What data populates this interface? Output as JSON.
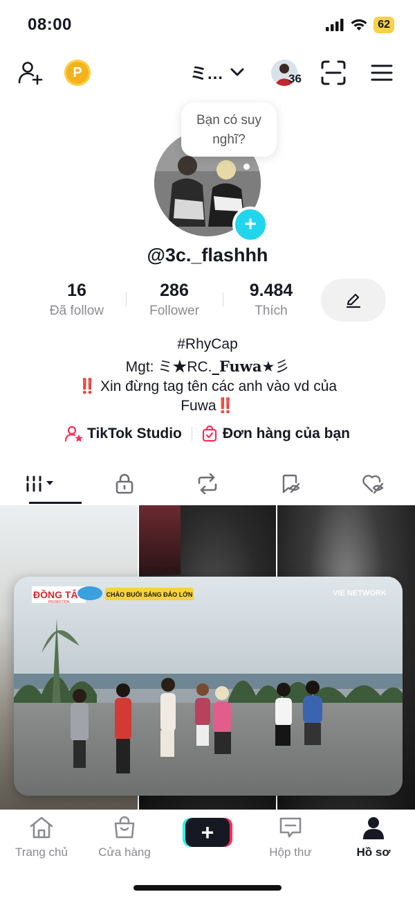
{
  "status_bar": {
    "time": "08:00",
    "battery": "62"
  },
  "header": {
    "account_switcher": "ミ…",
    "story_count": "36"
  },
  "profile": {
    "tooltip": [
      "Bạn có suy",
      "nghĩ?"
    ],
    "username": "@3c._flashhh",
    "stats": [
      {
        "value": "16",
        "label": "Đã follow"
      },
      {
        "value": "286",
        "label": "Follower"
      },
      {
        "value": "9.484",
        "label": "Thích"
      }
    ],
    "bio": {
      "line1": "#RhyCap",
      "line2_prefix": "Mgt: ミ★RC.",
      "line2_fancy": "_Fuwa",
      "line2_suffix": "★彡",
      "line3_marks": "‼️",
      "line3": "Xin đừng tag tên các anh vào vd của",
      "line4": "Fuwa",
      "line4_marks": "‼️"
    },
    "links": {
      "studio": "TikTok Studio",
      "orders": "Đơn hàng của bạn"
    }
  },
  "tabs": [
    "videos",
    "private",
    "reposts",
    "favorites",
    "liked"
  ],
  "pip_video": {
    "logo": "ĐỒNG TÂY",
    "logo_sub": "PROMOTION",
    "banner": "CHÀO BUỔI SÁNG ĐẢO LỚN",
    "watermark": "VIE NETWORK"
  },
  "bottom_nav": [
    {
      "label": "Trang chủ",
      "icon": "home-icon"
    },
    {
      "label": "Cửa hàng",
      "icon": "shop-bag-icon"
    },
    {
      "label": "Hộp thư",
      "icon": "inbox-icon"
    },
    {
      "label": "Hồ sơ",
      "icon": "profile-icon"
    }
  ],
  "colors": {
    "accent_cyan": "#20d5ec",
    "accent_red": "#fe2c55",
    "coin": "#f4b21b"
  }
}
